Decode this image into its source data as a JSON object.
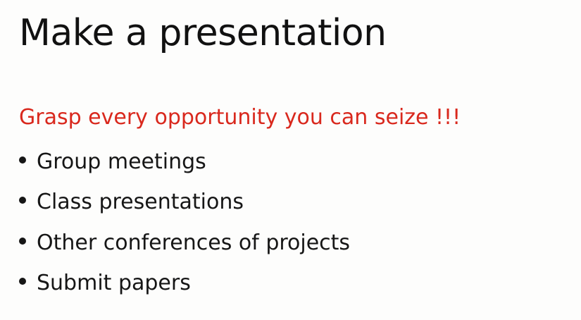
{
  "slide": {
    "title": "Make a presentation",
    "highlight": "Grasp every opportunity you can seize !!!",
    "bullets": [
      {
        "text": "Group meetings"
      },
      {
        "text": "Class presentations"
      },
      {
        "text": "Other conferences of projects"
      },
      {
        "text": "Submit papers"
      }
    ]
  },
  "colors": {
    "background": "#fdfdfc",
    "title": "#111111",
    "accent": "#d9281d",
    "body_text": "#161616"
  },
  "icons": {
    "bullet": "bullet-dot-icon"
  }
}
